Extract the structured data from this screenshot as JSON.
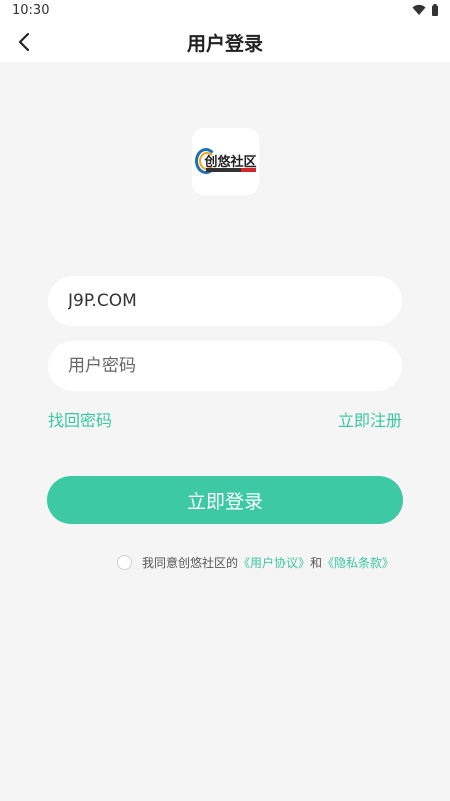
{
  "status_bar": {
    "time": "10:30"
  },
  "header": {
    "title": "用户登录"
  },
  "logo": {
    "text": "创悠社区"
  },
  "form": {
    "username_value": "J9P.COM",
    "password_placeholder": "用户密码"
  },
  "links": {
    "forgot": "找回密码",
    "register": "立即注册"
  },
  "login_button": "立即登录",
  "agreement": {
    "prefix": "我同意创悠社区的",
    "user_agreement": "《用户协议》",
    "and": "和",
    "privacy": "《隐私条款》"
  },
  "colors": {
    "accent": "#3cc9a3",
    "background": "#f5f5f5"
  }
}
